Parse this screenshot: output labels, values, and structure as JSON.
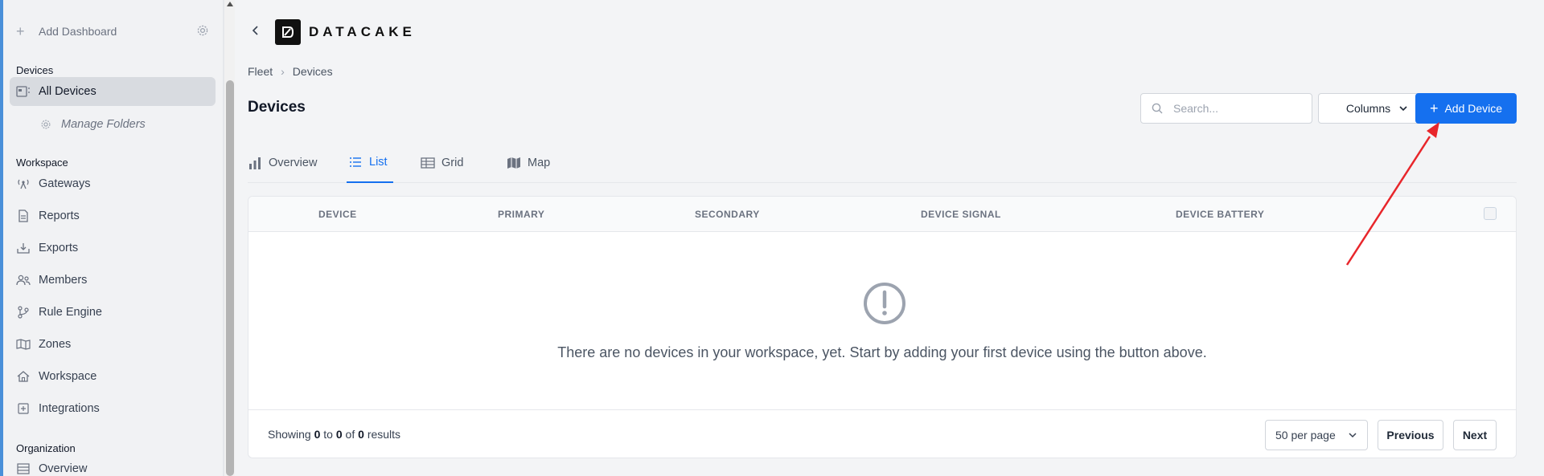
{
  "sidebar": {
    "add_dashboard": "Add Dashboard",
    "sections": {
      "devices": "Devices",
      "workspace": "Workspace",
      "organization": "Organization"
    },
    "items": [
      {
        "label": "All Devices",
        "icon": "device-icon",
        "active": true
      },
      {
        "label": "Manage Folders",
        "icon": "gear-icon"
      },
      {
        "label": "Gateways",
        "icon": "antenna-icon"
      },
      {
        "label": "Reports",
        "icon": "document-icon"
      },
      {
        "label": "Exports",
        "icon": "download-tray-icon"
      },
      {
        "label": "Members",
        "icon": "users-icon"
      },
      {
        "label": "Rule Engine",
        "icon": "branch-icon"
      },
      {
        "label": "Zones",
        "icon": "map-icon"
      },
      {
        "label": "Workspace",
        "icon": "home-icon"
      },
      {
        "label": "Integrations",
        "icon": "plus-box-icon"
      },
      {
        "label": "Overview",
        "icon": "table-icon"
      }
    ]
  },
  "header": {
    "brand": "DATACAKE",
    "breadcrumb": [
      "Fleet",
      "Devices"
    ],
    "title": "Devices",
    "search_placeholder": "Search...",
    "columns_label": "Columns",
    "add_device_label": "Add Device"
  },
  "tabs": [
    {
      "label": "Overview",
      "icon": "bar-chart-icon"
    },
    {
      "label": "List",
      "icon": "list-icon",
      "active": true
    },
    {
      "label": "Grid",
      "icon": "grid-icon"
    },
    {
      "label": "Map",
      "icon": "map-icon"
    }
  ],
  "table": {
    "columns": [
      "DEVICE",
      "PRIMARY",
      "SECONDARY",
      "DEVICE SIGNAL",
      "DEVICE BATTERY"
    ],
    "empty_message": "There are no devices in your workspace, yet. Start by adding your first device using the button above."
  },
  "footer": {
    "showing_prefix": "Showing",
    "from": "0",
    "to_word": "to",
    "to": "0",
    "of_word": "of",
    "total": "0",
    "results_word": "results",
    "per_page": "50 per page",
    "previous": "Previous",
    "next": "Next"
  },
  "colors": {
    "accent": "#1570ef",
    "annotation": "#e8262b"
  }
}
